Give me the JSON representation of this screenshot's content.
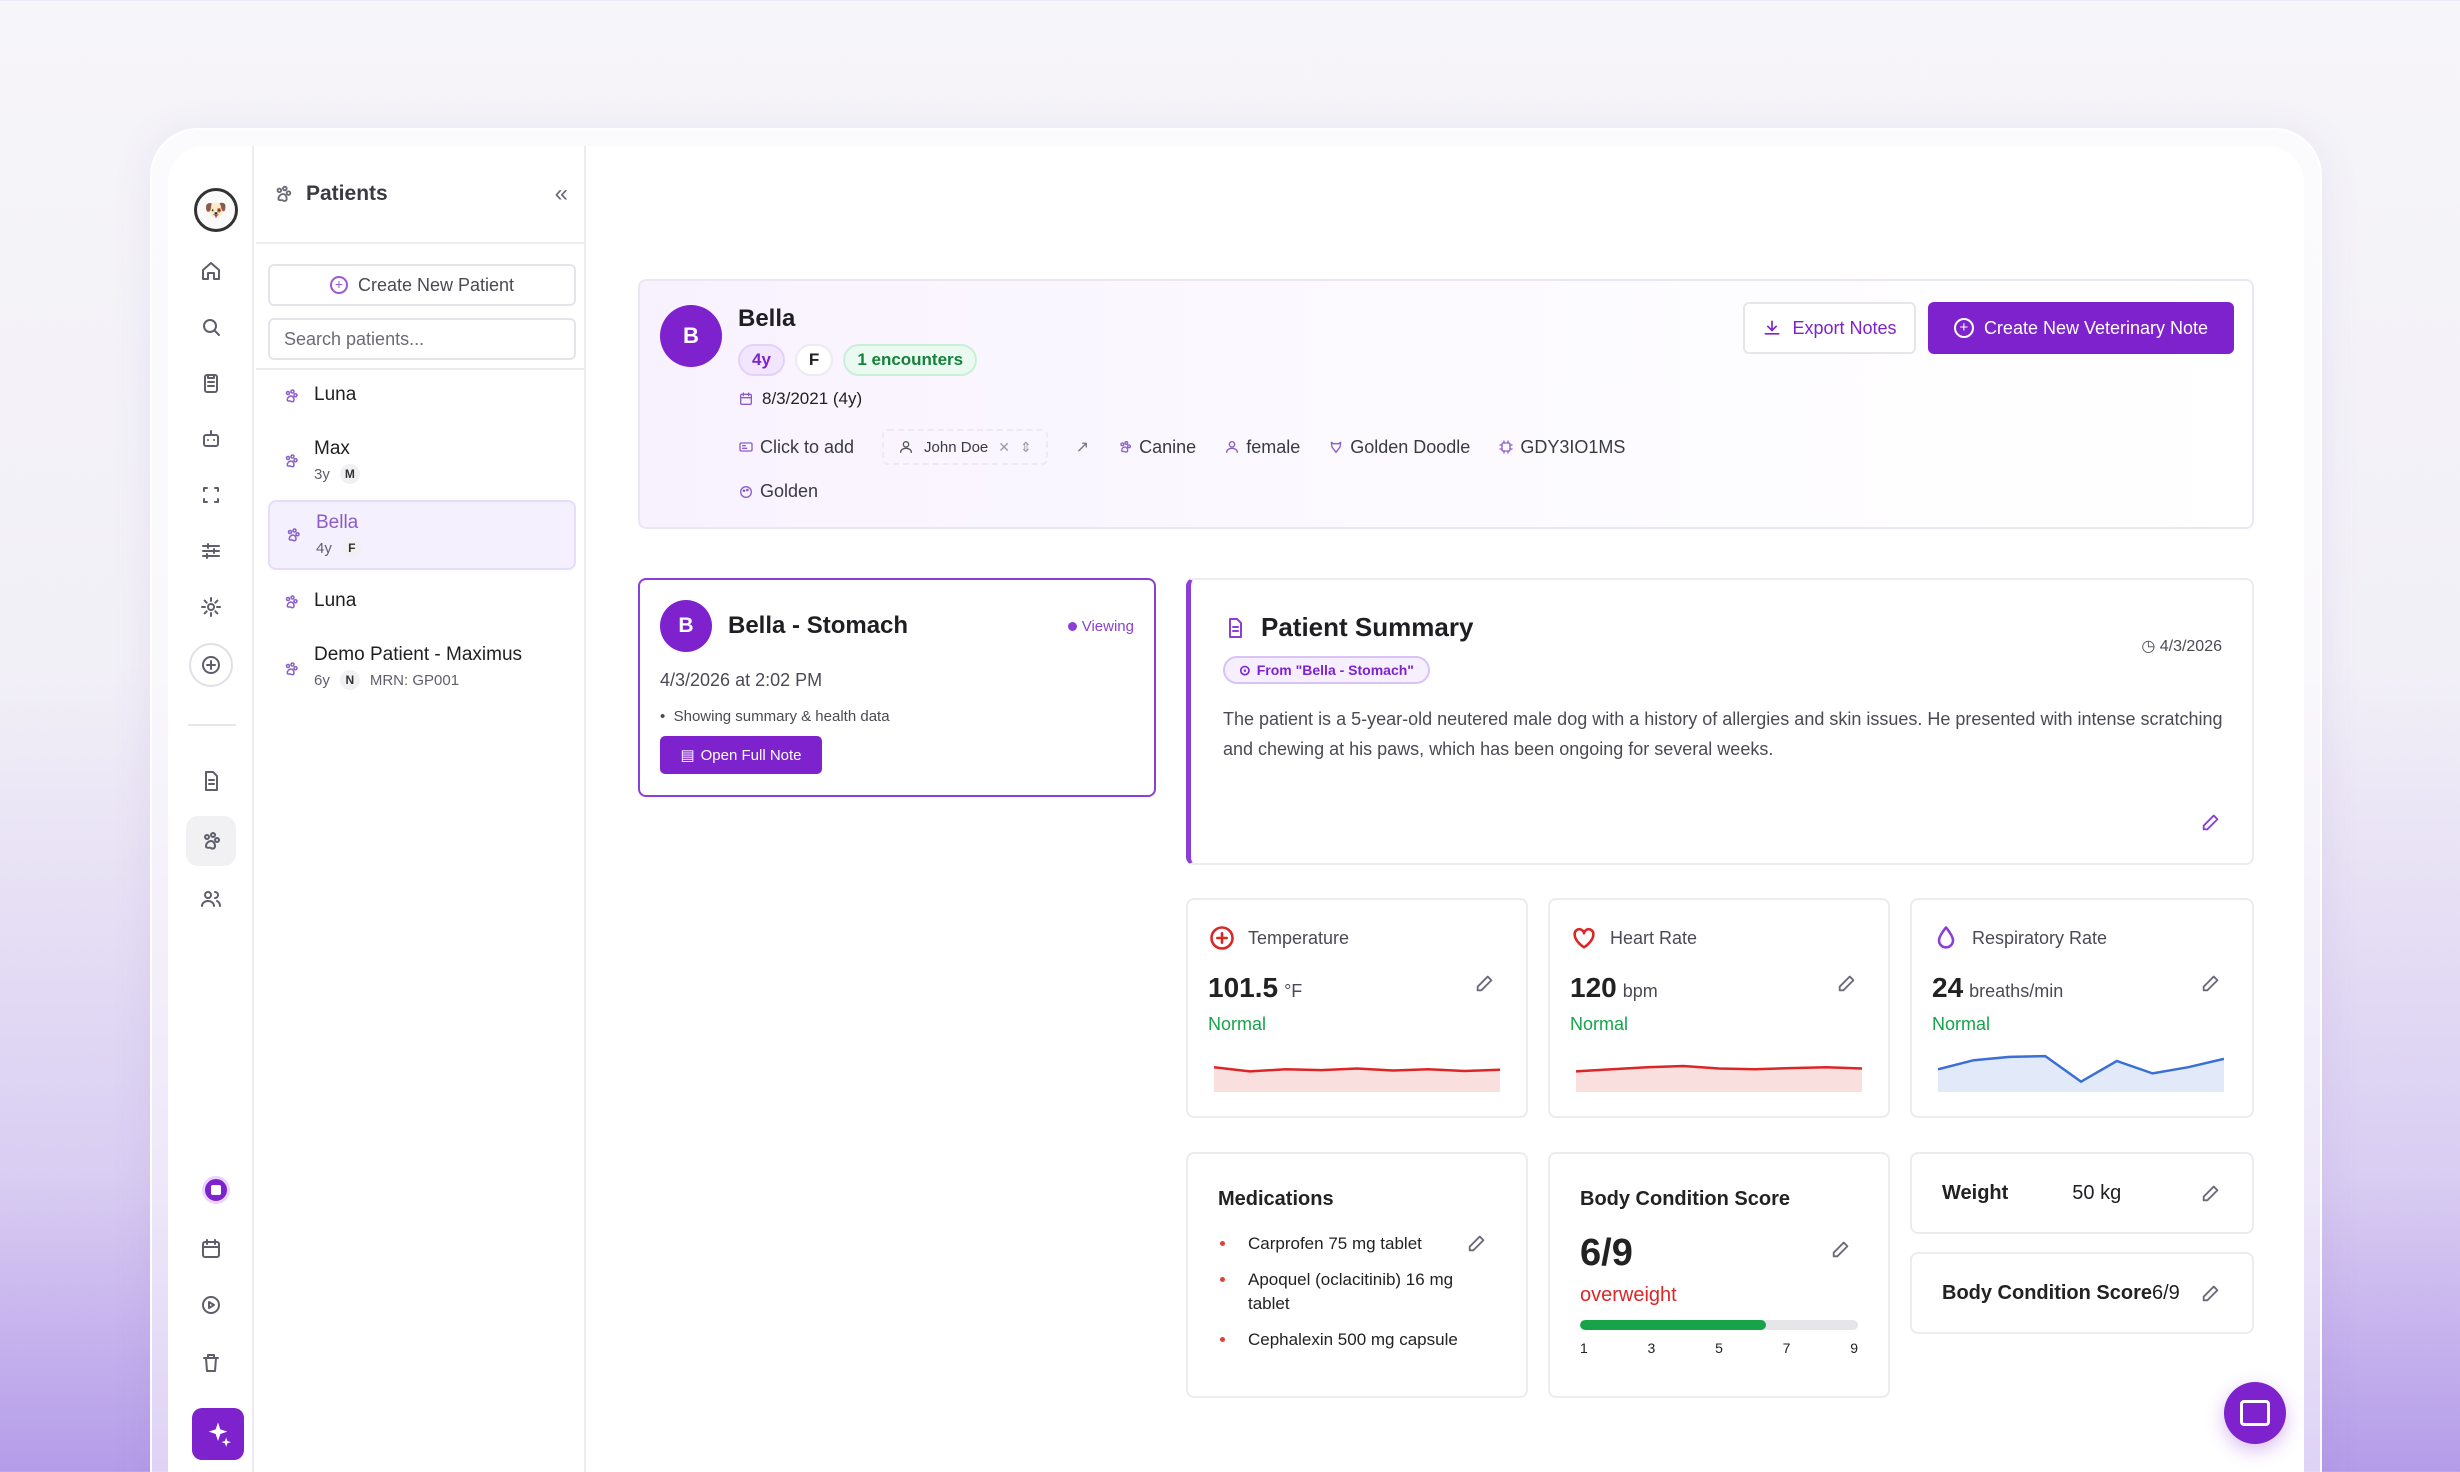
{
  "sidebar": {
    "nav_icons": [
      "home-icon",
      "search-icon",
      "clipboard-icon",
      "robot-icon",
      "scan-icon",
      "sliders-icon",
      "gear-icon",
      "plus-circle-icon",
      "document-icon",
      "paw-icon",
      "users-icon"
    ],
    "bottom_icons": [
      "avatar",
      "calendar-icon",
      "play-icon",
      "trash-icon",
      "sparkles-icon"
    ]
  },
  "patients_panel": {
    "title": "Patients",
    "create_label": "Create New Patient",
    "search_placeholder": "Search patients...",
    "patients": [
      {
        "name": "Luna",
        "age": "",
        "sex": "",
        "mrn": ""
      },
      {
        "name": "Max",
        "age": "3y",
        "sex": "M",
        "mrn": ""
      },
      {
        "name": "Bella",
        "age": "4y",
        "sex": "F",
        "mrn": ""
      },
      {
        "name": "Luna",
        "age": "",
        "sex": "",
        "mrn": ""
      },
      {
        "name": "Demo Patient - Maximus",
        "age": "6y",
        "sex": "N",
        "mrn": "MRN: GP001"
      }
    ]
  },
  "patient": {
    "initial": "B",
    "name": "Bella",
    "age_chip": "4y",
    "sex_chip": "F",
    "encounters_chip": "1 encounters",
    "dob": "8/3/2021 (4y)",
    "microchip": "Click to add",
    "owner": "John Doe",
    "species": "Canine",
    "sex": "female",
    "breed": "Golden Doodle",
    "code": "GDY3IO1MS",
    "color": "Golden",
    "export_label": "Export Notes",
    "new_note_label": "Create New Veterinary Note"
  },
  "note": {
    "initial": "B",
    "title": "Bella - Stomach",
    "viewing": "Viewing",
    "date": "4/3/2026 at 2:02 PM",
    "bullet": "Showing summary & health data",
    "open_label": "Open Full Note"
  },
  "summary": {
    "title": "Patient Summary",
    "date": "4/3/2026",
    "source": "From \"Bella - Stomach\"",
    "text": "The patient is a 5-year-old neutered male dog with a history of allergies and skin issues. He presented with intense scratching and chewing at his paws, which has been ongoing for several weeks."
  },
  "vitals": [
    {
      "label": "Temperature",
      "value": "101.5",
      "unit": "°F",
      "status": "Normal",
      "color": "#dc2626",
      "icon": "plus-circle-icon",
      "trend": [
        0.55,
        0.45,
        0.5,
        0.48,
        0.52,
        0.47,
        0.5,
        0.46,
        0.49
      ]
    },
    {
      "label": "Heart Rate",
      "value": "120",
      "unit": "bpm",
      "status": "Normal",
      "color": "#dc2626",
      "icon": "heart-icon",
      "trend": [
        0.45,
        0.5,
        0.55,
        0.58,
        0.52,
        0.5,
        0.53,
        0.55,
        0.52
      ]
    },
    {
      "label": "Respiratory Rate",
      "value": "24",
      "unit": "breaths/min",
      "status": "Normal",
      "color": "#3b6fd6",
      "icon": "droplet-icon",
      "trend": [
        0.5,
        0.72,
        0.8,
        0.82,
        0.2,
        0.7,
        0.4,
        0.55,
        0.75
      ]
    }
  ],
  "medications": {
    "title": "Medications",
    "items": [
      "Carprofen 75 mg tablet",
      "Apoquel (oclacitinib) 16 mg tablet",
      "Cephalexin 500 mg capsule"
    ]
  },
  "bcs": {
    "title": "Body Condition Score",
    "value": "6/9",
    "status": "overweight",
    "fill_fraction": 0.67,
    "ticks": [
      "1",
      "3",
      "5",
      "7",
      "9"
    ]
  },
  "weight": {
    "label": "Weight",
    "value": "50 kg"
  },
  "bcs_small": {
    "label": "Body Condition Score",
    "value": "6/9"
  }
}
